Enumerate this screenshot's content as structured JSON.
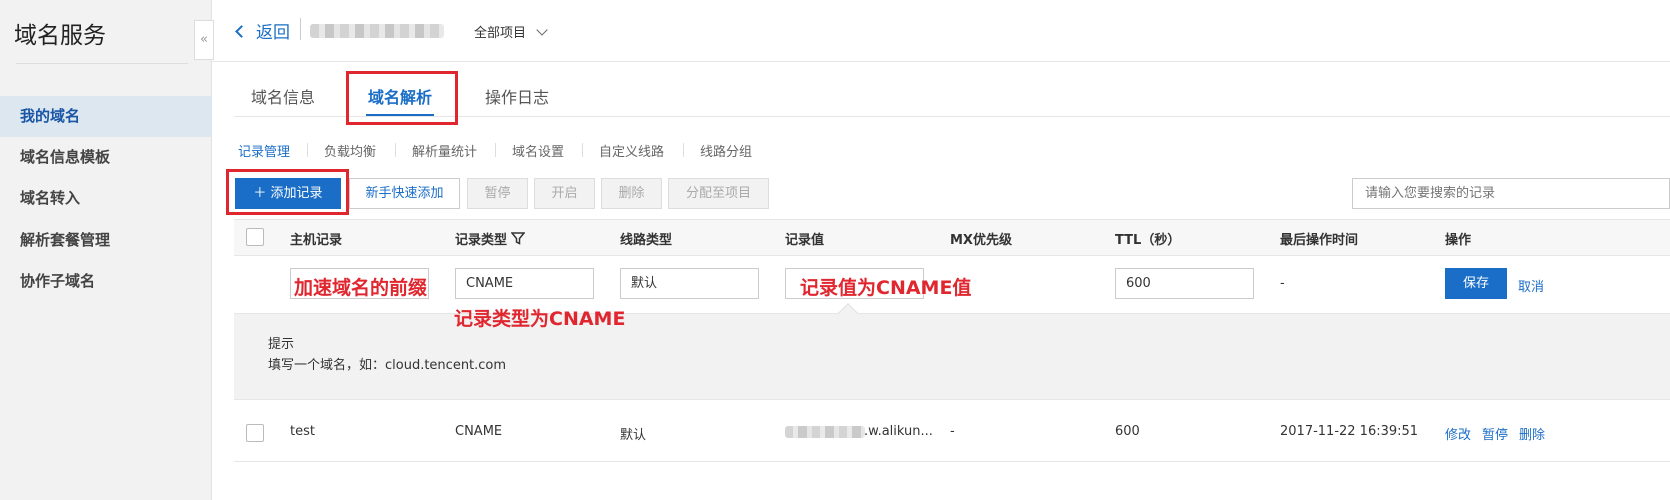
{
  "sidebar": {
    "title": "域名服务",
    "collapse_icon": "«",
    "items": [
      {
        "label": "我的域名",
        "active": true
      },
      {
        "label": "域名信息模板"
      },
      {
        "label": "域名转入"
      },
      {
        "label": "解析套餐管理"
      },
      {
        "label": "协作子域名"
      }
    ]
  },
  "header": {
    "back_label": "返回",
    "project_select": "全部项目"
  },
  "tabs": [
    {
      "label": "域名信息"
    },
    {
      "label": "域名解析",
      "active": true
    },
    {
      "label": "操作日志"
    }
  ],
  "subtabs": [
    {
      "label": "记录管理",
      "active": true
    },
    {
      "label": "负载均衡"
    },
    {
      "label": "解析量统计"
    },
    {
      "label": "域名设置"
    },
    {
      "label": "自定义线路"
    },
    {
      "label": "线路分组"
    }
  ],
  "toolbar": {
    "add_record": "＋ 添加记录",
    "quick_add": "新手快速添加",
    "pause": "暂停",
    "enable": "开启",
    "delete": "删除",
    "assign_project": "分配至项目",
    "search_placeholder": "请输入您要搜索的记录"
  },
  "table": {
    "headers": [
      "主机记录",
      "记录类型",
      "线路类型",
      "记录值",
      "MX优先级",
      "TTL（秒）",
      "最后操作时间",
      "操作"
    ],
    "edit_row": {
      "record_type": "CNAME",
      "line_type": "默认",
      "ttl": "600",
      "last_time": "-",
      "save": "保存",
      "cancel": "取消"
    },
    "annotations": {
      "host": "加速域名的前缀",
      "type": "记录类型为CNAME",
      "value": "记录值为CNAME值"
    },
    "hint": {
      "title": "提示",
      "text": "填写一个域名，如：cloud.tencent.com"
    },
    "rows": [
      {
        "host": "test",
        "type": "CNAME",
        "line": "默认",
        "value_suffix": ".w.alikun...",
        "mx": "-",
        "ttl": "600",
        "time": "2017-11-22 16:39:51",
        "actions": [
          "修改",
          "暂停",
          "删除"
        ]
      }
    ]
  },
  "colors": {
    "primary": "#1a6ec7",
    "annotation_red": "#e0262e",
    "sidebar_bg": "#f2f2f2"
  }
}
